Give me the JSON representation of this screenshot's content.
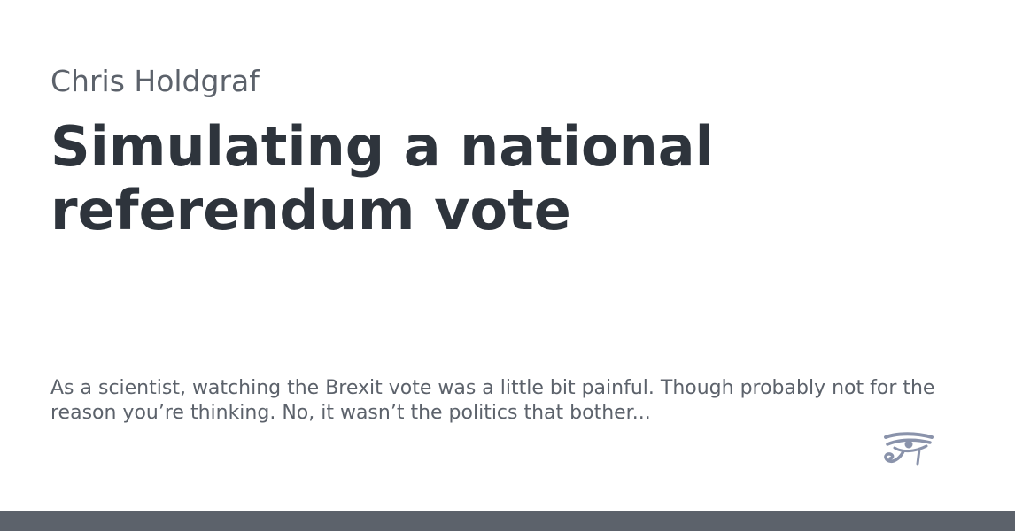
{
  "card": {
    "author": "Chris Holdgraf",
    "title": "Simulating a national referendum vote",
    "description": "As a scientist, watching the Brexit vote was a little bit painful. Though probably not for the reason you’re thinking. No, it wasn’t the politics that bother...",
    "logo_icon": "eye-of-horus-icon"
  },
  "colors": {
    "title": "#2e343c",
    "muted_text": "#5c626b",
    "logo": "#8a93ab",
    "bottom_bar": "#5c626b",
    "background": "#ffffff"
  }
}
